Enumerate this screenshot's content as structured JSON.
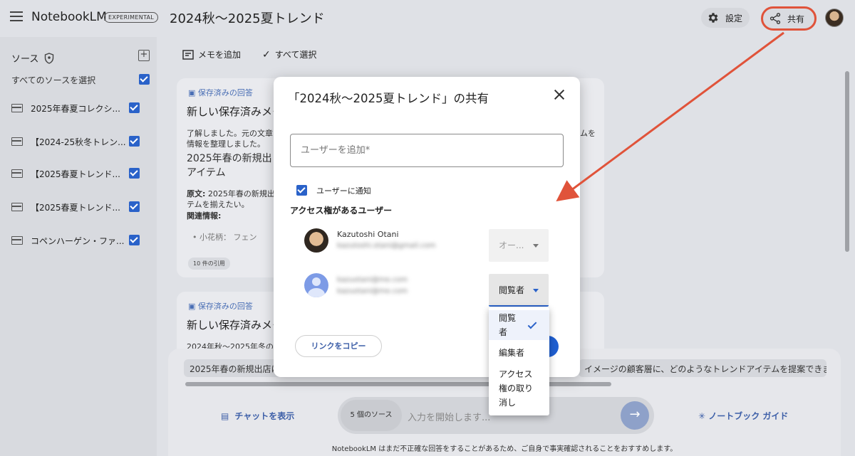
{
  "app": {
    "name": "NotebookLM",
    "badge": "EXPERIMENTAL",
    "notebook_title": "2024秋〜2025夏トレンド"
  },
  "header": {
    "settings_label": "設定",
    "share_label": "共有"
  },
  "sidebar": {
    "heading": "ソース",
    "select_all": "すべてのソースを選択",
    "items": [
      {
        "label": "2025年春夏コレクシ..."
      },
      {
        "label": "【2024-25秋冬トレン..."
      },
      {
        "label": "【2025春夏トレンド..."
      },
      {
        "label": "【2025春夏トレンド..."
      },
      {
        "label": "コペンハーゲン・ファ..."
      }
    ]
  },
  "toolbar": {
    "add_note": "メモを追加",
    "select_all": "すべて選択"
  },
  "notes": [
    {
      "label": "保存済みの回答",
      "title": "新しい保存済みメモ",
      "text_1": "了解しました。元の文章",
      "text_1b": "ムを",
      "text_2": "情報を整理しました。",
      "heading_1": "2025年春の新規出",
      "heading_2": "アイテム",
      "orig_label": "原文:",
      "orig_text": "2025年春の新規出",
      "orig_text_2": "テムを揃えたい。",
      "related": "関連情報:",
      "bullet": "小花柄： フェン",
      "citations": "10 件の引用"
    },
    {
      "label": "保存済みの回答",
      "title": "新しい保存済みメモ",
      "text_1": "2024年秋〜2025年冬の"
    }
  ],
  "bottom": {
    "suggestion_1": "2025年春の新規出店に",
    "suggestion_2": "イメージの顧客層に、どのようなトレンドアイテムを提案できます",
    "show_chat": "チャットを表示",
    "source_count": "5 個のソース",
    "input_placeholder": "入力を開始します...",
    "notebook_guide": "ノートブック ガイド",
    "disclaimer": "NotebookLM はまだ不正確な回答をすることがあるため、ご自身で事実確認されることをおすすめします。"
  },
  "share_dialog": {
    "title": "「2024秋〜2025夏トレンド」の共有",
    "add_user_placeholder": "ユーザーを追加*",
    "notify_label": "ユーザーに通知",
    "notify_checked": true,
    "access_heading": "アクセス権があるユーザー",
    "users": [
      {
        "name": "Kazutoshi Otani",
        "email": "kazutoshi.otani@gmail.com",
        "role": "オー..."
      },
      {
        "name": "kazuotani@me.com",
        "email": "kazuotani@me.com",
        "role": "閲覧者"
      }
    ],
    "copy_link": "リンクをコピー",
    "role_menu": [
      {
        "label": "閲覧\n者",
        "selected": true
      },
      {
        "label": "編集者",
        "selected": false
      },
      {
        "label": "アクセス\n権の取り\n消し",
        "selected": false
      }
    ]
  },
  "colors": {
    "accent": "#2a62c9",
    "annotation": "#e0533a"
  }
}
